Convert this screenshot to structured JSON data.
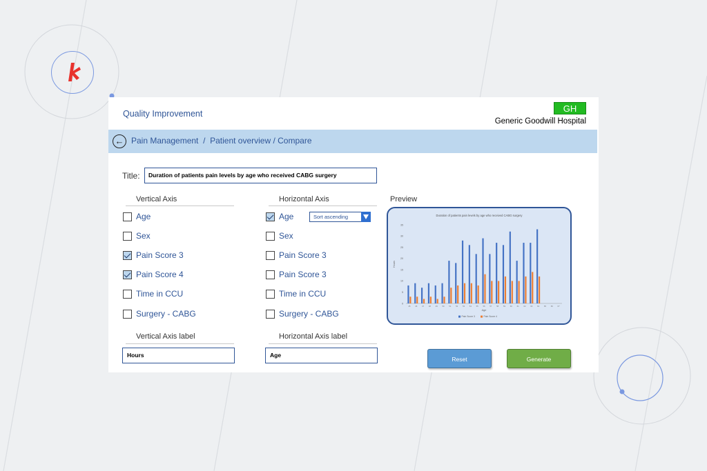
{
  "header": {
    "app_title": "Quality Improvement",
    "badge": "GH",
    "hospital": "Generic Goodwill Hospital"
  },
  "breadcrumb": {
    "back_icon": "arrow-left-icon",
    "item1": "Pain Management",
    "sep": "/",
    "item2": "Patient overview / Compare"
  },
  "form": {
    "title_label": "Title:",
    "title_value": "Duration of patients pain levels by age who received CABG surgery",
    "vertical_axis": {
      "heading": "Vertical Axis",
      "options": [
        {
          "label": "Age",
          "checked": false
        },
        {
          "label": "Sex",
          "checked": false
        },
        {
          "label": "Pain Score 3",
          "checked": true
        },
        {
          "label": "Pain Score 4",
          "checked": true
        },
        {
          "label": "Time in CCU",
          "checked": false
        },
        {
          "label": "Surgery - CABG",
          "checked": false
        }
      ],
      "label_heading": "Vertical Axis label",
      "label_value": "Hours"
    },
    "horizontal_axis": {
      "heading": "Horizontal Axis",
      "options": [
        {
          "label": "Age",
          "checked": true
        },
        {
          "label": "Sex",
          "checked": false
        },
        {
          "label": "Pain Score 3",
          "checked": false
        },
        {
          "label": "Pain Score 3",
          "checked": false
        },
        {
          "label": "Time in CCU",
          "checked": false
        },
        {
          "label": "Surgery - CABG",
          "checked": false
        }
      ],
      "sort_value": "Sort ascending",
      "label_heading": "Horizontal Axis label",
      "label_value": "Age"
    }
  },
  "preview": {
    "label": "Preview"
  },
  "buttons": {
    "reset": "Reset",
    "generate": "Generate"
  },
  "colors": {
    "accent_blue": "#2f5597",
    "navbar": "#bdd7ee",
    "badge_green": "#22bb22",
    "reset_blue": "#5b9bd5",
    "generate_green": "#70ad47",
    "series_blue": "#4472c4",
    "series_orange": "#ed7d31",
    "logo_red": "#e8322d"
  },
  "chart_data": {
    "type": "bar",
    "title": "Duration of patients pain levels by age who received CABG surgery",
    "xlabel": "Age",
    "ylabel": "Hours",
    "ylim": [
      0,
      35
    ],
    "yticks": [
      0,
      5,
      10,
      15,
      20,
      25,
      30,
      35
    ],
    "categories": [
      "45",
      "46",
      "47",
      "48",
      "49",
      "50",
      "51",
      "52",
      "53",
      "54",
      "55",
      "56",
      "57",
      "58",
      "59",
      "60",
      "61",
      "62",
      "63",
      "64",
      "65",
      "66",
      "67"
    ],
    "series": [
      {
        "name": "Pain Score 3",
        "color": "#4472c4",
        "values": [
          8,
          9,
          7,
          9,
          8,
          9,
          19,
          18,
          28,
          26,
          22,
          29,
          22,
          27,
          26,
          32,
          19,
          27,
          27,
          33,
          0,
          0,
          0
        ]
      },
      {
        "name": "Pain Score 4",
        "color": "#ed7d31",
        "values": [
          3,
          3,
          2,
          3,
          2,
          3,
          7,
          8,
          9,
          9,
          8,
          13,
          10,
          10,
          12,
          10,
          10,
          12,
          14,
          12,
          0,
          0,
          0
        ]
      }
    ],
    "legend": "bottom",
    "grid": false
  }
}
